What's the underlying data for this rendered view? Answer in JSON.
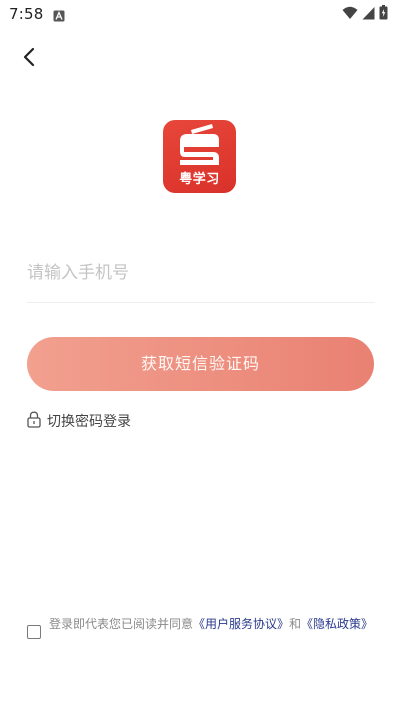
{
  "status_bar": {
    "time": "7:58",
    "notification_icon": "a-letter-icon",
    "icons": [
      "wifi-icon",
      "cell-signal-icon",
      "battery-icon"
    ]
  },
  "header": {
    "back_icon": "chevron-left-icon"
  },
  "logo": {
    "text": "粤学习",
    "color": "#e03b31"
  },
  "phone": {
    "placeholder": "请输入手机号",
    "value": ""
  },
  "sms_button": {
    "label": "获取短信验证码",
    "color": "#ec8b7c"
  },
  "switch_login": {
    "label": "切换密码登录",
    "icon": "lock-icon"
  },
  "agreement": {
    "checked": false,
    "prefix": "登录即代表您已阅读并同意",
    "user_agreement": "《用户服务协议》",
    "connector": "和",
    "privacy_policy": "《隐私政策》"
  }
}
